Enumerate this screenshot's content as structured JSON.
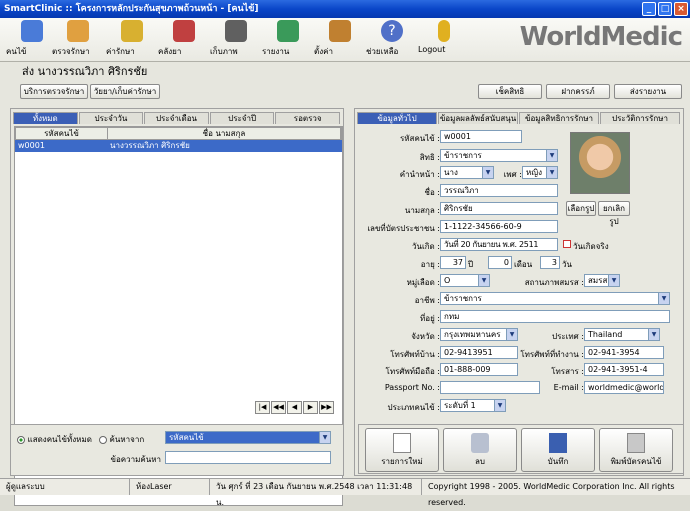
{
  "window": {
    "title": "SmartClinic :: โครงการหลักประกันสุขภาพถ้วนหน้า - [คนไข้]"
  },
  "toolbar": {
    "items": [
      {
        "label": "คนไข้",
        "icon": "patient-icon"
      },
      {
        "label": "ตรวจรักษา",
        "icon": "doctor-icon"
      },
      {
        "label": "ค่ารักษา",
        "icon": "money-icon"
      },
      {
        "label": "คลังยา",
        "icon": "pills-icon"
      },
      {
        "label": "เก็บภาพ",
        "icon": "camera-icon"
      },
      {
        "label": "รายงาน",
        "icon": "chart-icon"
      },
      {
        "label": "ตั้งค่า",
        "icon": "tools-icon"
      },
      {
        "label": "ช่วยเหลือ",
        "icon": "help-icon"
      },
      {
        "label": "Logout",
        "icon": "logout-icon"
      }
    ]
  },
  "brand": {
    "text": "WorldMedic"
  },
  "patient": {
    "heading": "ส่ง นางวรรณวิภา ศิริกรชัย"
  },
  "subbar": {
    "btn1": "บริการตรวจรักษา",
    "btn2": "วัยยา/เก็บค่ารักษา",
    "btn3": "เช็คสิทธิ",
    "btn4": "ฝากครรภ์",
    "btn5": "ส่งรายงาน"
  },
  "left": {
    "tabs": [
      "ทั้งหมด",
      "ประจำวัน",
      "ประจำเดือน",
      "ประจำปี",
      "รอตรวจ"
    ],
    "columns": [
      "รหัสคนไข้",
      "ชื่อ นามสกุล"
    ],
    "rows": [
      {
        "id": "w0001",
        "name": "นางวรรณวิภา ศิริกรชัย"
      }
    ],
    "pager": [
      "|◀",
      "◀◀",
      "◀",
      "▶",
      "▶▶"
    ]
  },
  "search": {
    "show_all": "แสดงคนไข้ทั้งหมด",
    "search_by": "ค้นหาจาก",
    "search_field": "รหัสคนไข้",
    "text_label": "ข้อความค้นหา"
  },
  "right": {
    "tabs": [
      "ข้อมูลทั่วไป",
      "ข้อมูลผลลัพธ์สนับสนุน",
      "ข้อมูลสิทธิการรักษา",
      "ประวัติการรักษา"
    ],
    "fields": {
      "patient_id_label": "รหัสคนไข้ :",
      "patient_id": "w0001",
      "right_label": "สิทธิ :",
      "right": "ข้าราชการ",
      "prefix_label": "คำนำหน้า :",
      "prefix": "นาง",
      "sex_label": "เพศ :",
      "sex": "หญิง",
      "name_label": "ชื่อ :",
      "name": "วรรณวิภา",
      "surname_label": "นามสกุล :",
      "surname": "ศิริกรชัย",
      "idcard_label": "เลขที่บัตรประชาชน :",
      "idcard": "1-1122-34566-60-9",
      "dob_label": "วันเกิด :",
      "dob_day": "วันที่ 20",
      "dob_month": "กันยายน",
      "dob_year": "พ.ศ. 2511",
      "real_dob": "วันเกิดจริง",
      "age_label": "อายุ :",
      "age_y": "37",
      "unit_y": "ปี",
      "age_m": "0",
      "unit_m": "เดือน",
      "age_d": "3",
      "unit_d": "วัน",
      "blood_label": "หมู่เลือด :",
      "blood": "O",
      "marital_label": "สถานภาพสมรส :",
      "marital": "สมรส",
      "job_label": "อาชีพ :",
      "job": "ข้าราชการ",
      "addr_label": "ที่อยู่ :",
      "addr": "กทม",
      "province_label": "จังหวัด :",
      "province": "กรุงเทพมหานคร",
      "country_label": "ประเทศ :",
      "country": "Thailand",
      "home_tel_label": "โทรศัพท์บ้าน :",
      "home_tel": "02-9413951",
      "work_tel_label": "โทรศัพท์ที่ทำงาน :",
      "work_tel": "02-941-3954",
      "mobile_label": "โทรศัพท์มือถือ :",
      "mobile": "01-888-009",
      "fax_label": "โทรสาร :",
      "fax": "02-941-3951-4",
      "passport_label": "Passport No. :",
      "passport": "",
      "email_label": "E-mail :",
      "email": "worldmedic@worldmedic.com",
      "ptype_label": "ประเภทคนไข้ :",
      "ptype": "ระดับที่ 1"
    },
    "photo_btn1": "เลือกรูป",
    "photo_btn2": "ยกเลิกรูป"
  },
  "actions": {
    "new": "รายการใหม่",
    "delete": "ลบ",
    "save": "บันทึก",
    "print": "พิมพ์บัตรคนไข้"
  },
  "status": {
    "user": "ผู้ดูแลระบบ",
    "station": "ห้องLaser",
    "datetime": "วัน ศุกร์ ที่ 23 เดือน กันยายน พ.ศ.2548 เวลา 11:31:48 น.",
    "copyright": "Copyright 1998 - 2005. WorldMedic Corporation Inc. All rights reserved."
  }
}
